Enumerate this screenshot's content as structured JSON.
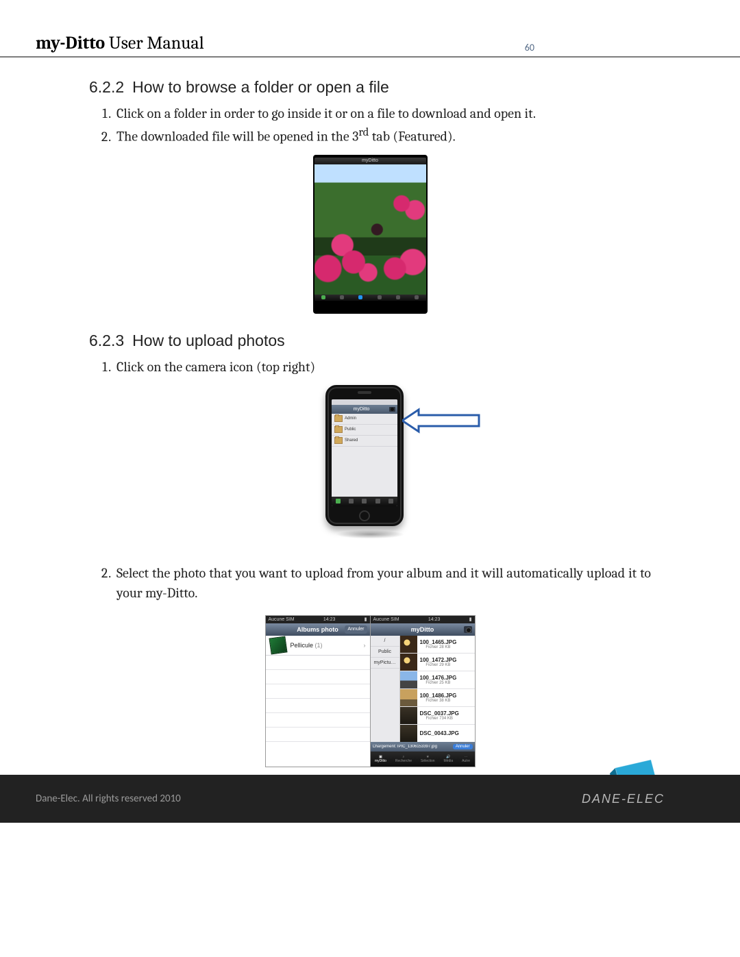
{
  "header": {
    "title_bold": "my-Ditto",
    "title_rest": " User Manual",
    "page_number": "60"
  },
  "section1": {
    "number": "6.2.2",
    "title": "How to browse a folder or open a file",
    "items": [
      "Click on a folder in order to go inside it or on a file to download and open it.",
      "The downloaded file will be opened in the 3rd tab (Featured)."
    ],
    "ordinal_suffix": "rd",
    "fig": {
      "app_title": "myDitto"
    }
  },
  "section2": {
    "number": "6.2.3",
    "title": "How to upload photos",
    "items": [
      "Click on the camera icon (top right)",
      "Select the photo that you want to upload from your album and it will automatically upload it to your my-Ditto."
    ],
    "phone_folders": [
      "Admin",
      "Public",
      "Shared"
    ],
    "phone_nav_title": "myDitto"
  },
  "fig3": {
    "left": {
      "status_carrier": "Aucune SIM",
      "status_time": "14:23",
      "nav_title": "Albums photo",
      "annuler": "Annuler",
      "album_label": "Pellicule",
      "album_count": "(1)"
    },
    "right": {
      "status_carrier": "Aucune SIM",
      "status_time": "14:23",
      "nav_title": "myDitto",
      "side_items": [
        "/",
        "Public",
        "myPictu…"
      ],
      "files": [
        {
          "name": "100_1465.JPG",
          "size": "Fichier 28 KB",
          "th": "a"
        },
        {
          "name": "100_1472.JPG",
          "size": "Fichier 29 KB",
          "th": "a"
        },
        {
          "name": "100_1476.JPG",
          "size": "Fichier 25 KB",
          "th": "b"
        },
        {
          "name": "100_1486.JPG",
          "size": "Fichier 38 KB",
          "th": "c"
        },
        {
          "name": "DSC_0037.JPG",
          "size": "Fichier 734 KB",
          "th": "d"
        },
        {
          "name": "DSC_0043.JPG",
          "size": "",
          "th": "d"
        }
      ],
      "loading_text": "Chargement: IPIC_1306153397.jpg",
      "loading_btn": "Annuler",
      "tabs": [
        "myDitto",
        "Recherche",
        "Sélection",
        "Média",
        "Autre"
      ]
    }
  },
  "footer": {
    "copyright": "Dane-Elec. All rights reserved 2010",
    "brand": "DANE-ELEC"
  }
}
